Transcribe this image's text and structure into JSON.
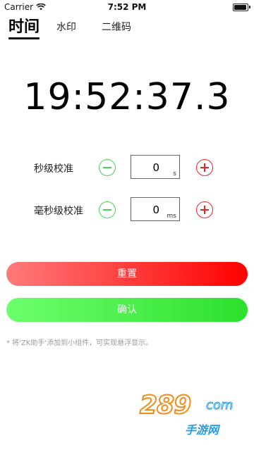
{
  "status": {
    "carrier": "Carrier",
    "time": "7:52 PM",
    "battery_level": 0.95
  },
  "tabs": [
    {
      "label": "时间",
      "active": true
    },
    {
      "label": "水印",
      "active": false
    },
    {
      "label": "二维码",
      "active": false
    }
  ],
  "clock": "19:52:37.3",
  "calibration": {
    "seconds": {
      "label": "秒级校准",
      "value": "0",
      "unit": "s"
    },
    "milliseconds": {
      "label": "毫秒级校准",
      "value": "0",
      "unit": "ms"
    }
  },
  "buttons": {
    "reset": "重置",
    "confirm": "确认"
  },
  "hint": "* 将'ZK助手'添加到小组件，可实现悬浮显示。",
  "watermark": {
    "number": "289",
    "suffix": "com",
    "text": "手游网"
  },
  "colors": {
    "minus_green": "#4CD25A",
    "plus_red": "#E02828",
    "reset_gradient": [
      "#ff7b7b",
      "#ff0000"
    ],
    "confirm_gradient": [
      "#6dff6d",
      "#2de02d"
    ]
  }
}
